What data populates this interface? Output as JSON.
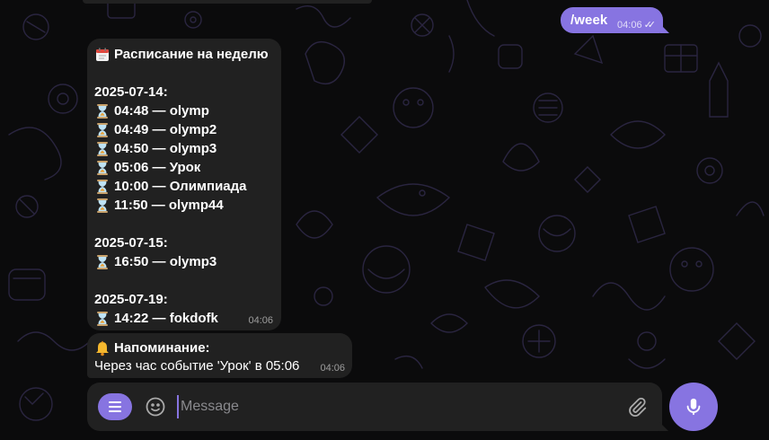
{
  "outgoing": {
    "text": "/week",
    "time": "04:06",
    "status_icon": "double-check-icon"
  },
  "schedule": {
    "title": "Расписание на неделю",
    "title_icon": "calendar-icon",
    "days": [
      {
        "date": "2025-07-14:",
        "events": [
          "04:48 — olymp",
          "04:49 — olymp2",
          "04:50 — olymp3",
          "05:06 — Урок",
          "10:00 — Олимпиада",
          "11:50 — olymp44"
        ]
      },
      {
        "date": "2025-07-15:",
        "events": [
          "16:50 — olymp3"
        ]
      },
      {
        "date": "2025-07-19:",
        "events": [
          "14:22 — fokdofk"
        ]
      }
    ],
    "event_icon": "hourglass-icon",
    "time": "04:06"
  },
  "reminder": {
    "title": "Напоминание:",
    "title_icon": "bell-icon",
    "text": "Через час событие 'Урок' в 05:06",
    "time": "04:06"
  },
  "composer": {
    "placeholder": "Message",
    "value": "",
    "menu_icon": "menu-icon",
    "emoji_icon": "smile-icon",
    "attach_icon": "paperclip-icon",
    "mic_icon": "microphone-icon"
  },
  "colors": {
    "accent": "#8774e1",
    "bubble": "#212121",
    "background": "#0b0b0c"
  }
}
